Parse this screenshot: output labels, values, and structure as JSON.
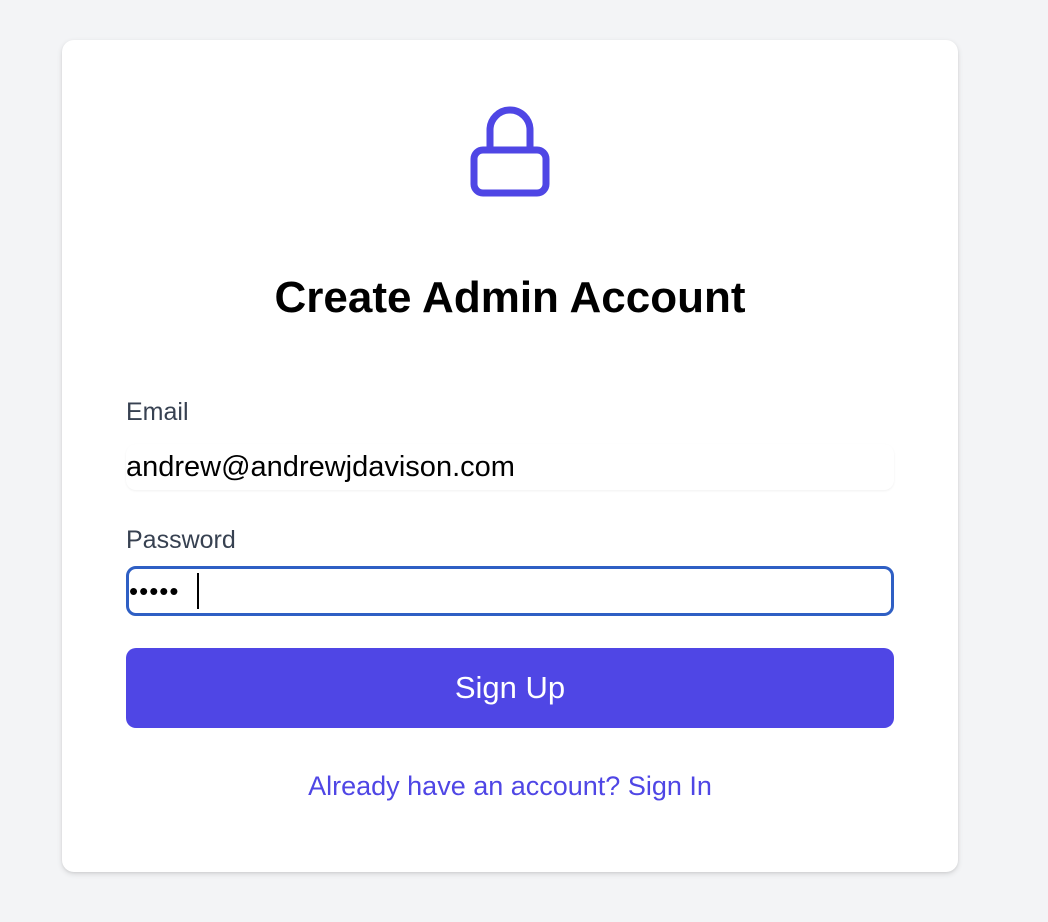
{
  "form": {
    "icon": "lock-icon",
    "title": "Create Admin Account",
    "email_label": "Email",
    "email_value": "andrew@andrewjdavison.com",
    "password_label": "Password",
    "password_value": "•••••",
    "submit_label": "Sign Up",
    "signin_link": "Already have an account? Sign In"
  },
  "colors": {
    "accent": "#4f46e5",
    "background": "#f3f4f6",
    "focus_ring": "#2f5fc4"
  }
}
